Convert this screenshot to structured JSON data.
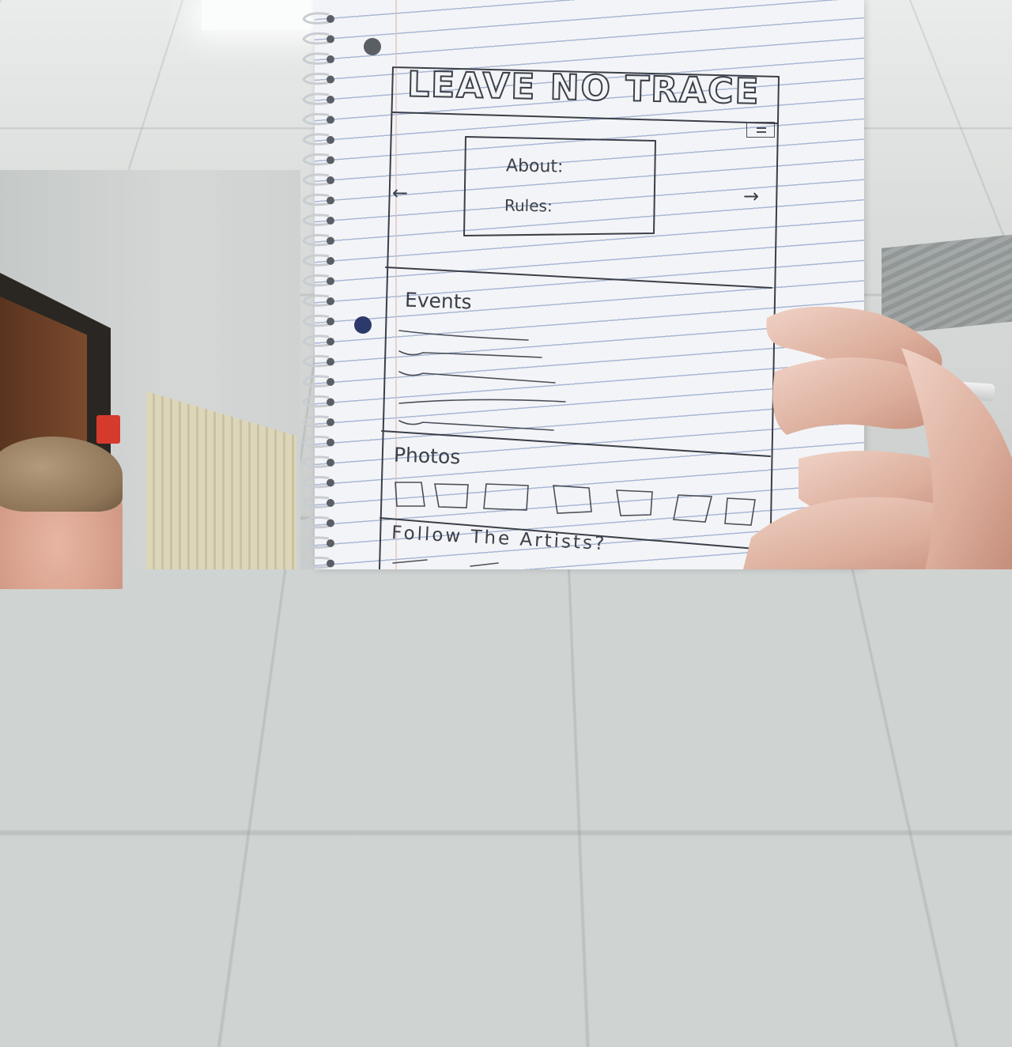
{
  "sketch": {
    "title": "LEAVE NO TRACE",
    "carousel": {
      "about_label": "About:",
      "rules_label": "Rules:",
      "prev_arrow": "←",
      "next_arrow": "→"
    },
    "events_heading": "Events",
    "photos_heading": "Photos",
    "follow_heading": "Follow The Artists?"
  },
  "icons": [
    "menu-icon",
    "arrow-left-icon",
    "arrow-right-icon"
  ],
  "colors": {
    "ink": "#3a3f48",
    "paper": "#f3f4f7",
    "rule_lines": "#a9b8d6"
  }
}
